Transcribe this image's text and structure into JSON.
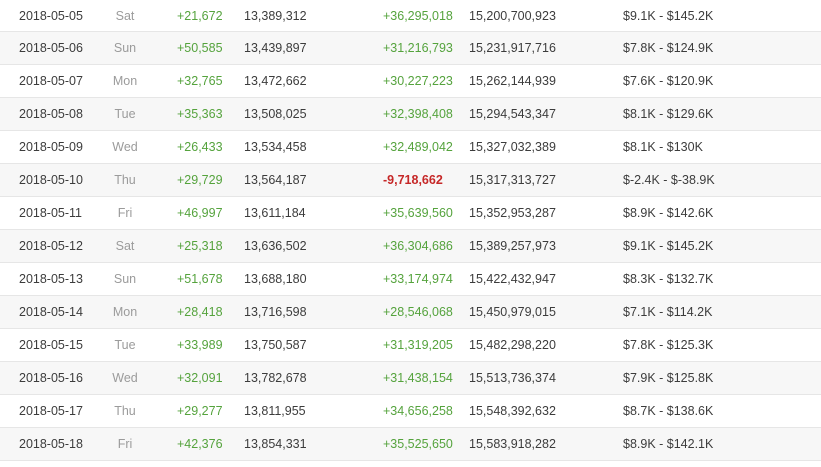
{
  "rows": [
    {
      "date": "2018-05-05",
      "dow": "Sat",
      "sub_delta": "+21,672",
      "subs": "13,389,312",
      "view_delta": "+36,295,018",
      "views": "15,200,700,923",
      "earnings": "$9.1K  -  $145.2K"
    },
    {
      "date": "2018-05-06",
      "dow": "Sun",
      "sub_delta": "+50,585",
      "subs": "13,439,897",
      "view_delta": "+31,216,793",
      "views": "15,231,917,716",
      "earnings": "$7.8K  -  $124.9K"
    },
    {
      "date": "2018-05-07",
      "dow": "Mon",
      "sub_delta": "+32,765",
      "subs": "13,472,662",
      "view_delta": "+30,227,223",
      "views": "15,262,144,939",
      "earnings": "$7.6K  -  $120.9K"
    },
    {
      "date": "2018-05-08",
      "dow": "Tue",
      "sub_delta": "+35,363",
      "subs": "13,508,025",
      "view_delta": "+32,398,408",
      "views": "15,294,543,347",
      "earnings": "$8.1K  -  $129.6K"
    },
    {
      "date": "2018-05-09",
      "dow": "Wed",
      "sub_delta": "+26,433",
      "subs": "13,534,458",
      "view_delta": "+32,489,042",
      "views": "15,327,032,389",
      "earnings": "$8.1K  -  $130K"
    },
    {
      "date": "2018-05-10",
      "dow": "Thu",
      "sub_delta": "+29,729",
      "subs": "13,564,187",
      "view_delta": "-9,718,662",
      "views": "15,317,313,727",
      "earnings": "$-2.4K  -  $-38.9K"
    },
    {
      "date": "2018-05-11",
      "dow": "Fri",
      "sub_delta": "+46,997",
      "subs": "13,611,184",
      "view_delta": "+35,639,560",
      "views": "15,352,953,287",
      "earnings": "$8.9K  -  $142.6K"
    },
    {
      "date": "2018-05-12",
      "dow": "Sat",
      "sub_delta": "+25,318",
      "subs": "13,636,502",
      "view_delta": "+36,304,686",
      "views": "15,389,257,973",
      "earnings": "$9.1K  -  $145.2K"
    },
    {
      "date": "2018-05-13",
      "dow": "Sun",
      "sub_delta": "+51,678",
      "subs": "13,688,180",
      "view_delta": "+33,174,974",
      "views": "15,422,432,947",
      "earnings": "$8.3K  -  $132.7K"
    },
    {
      "date": "2018-05-14",
      "dow": "Mon",
      "sub_delta": "+28,418",
      "subs": "13,716,598",
      "view_delta": "+28,546,068",
      "views": "15,450,979,015",
      "earnings": "$7.1K  -  $114.2K"
    },
    {
      "date": "2018-05-15",
      "dow": "Tue",
      "sub_delta": "+33,989",
      "subs": "13,750,587",
      "view_delta": "+31,319,205",
      "views": "15,482,298,220",
      "earnings": "$7.8K  -  $125.3K"
    },
    {
      "date": "2018-05-16",
      "dow": "Wed",
      "sub_delta": "+32,091",
      "subs": "13,782,678",
      "view_delta": "+31,438,154",
      "views": "15,513,736,374",
      "earnings": "$7.9K  -  $125.8K"
    },
    {
      "date": "2018-05-17",
      "dow": "Thu",
      "sub_delta": "+29,277",
      "subs": "13,811,955",
      "view_delta": "+34,656,258",
      "views": "15,548,392,632",
      "earnings": "$8.7K  -  $138.6K"
    },
    {
      "date": "2018-05-18",
      "dow": "Fri",
      "sub_delta": "+42,376",
      "subs": "13,854,331",
      "view_delta": "+35,525,650",
      "views": "15,583,918,282",
      "earnings": "$8.9K  -  $142.1K"
    }
  ],
  "colors": {
    "positive": "#55a33d",
    "negative": "#c62828",
    "row_alt_bg": "#f7f7f7",
    "divider": "#e6e6e6"
  }
}
